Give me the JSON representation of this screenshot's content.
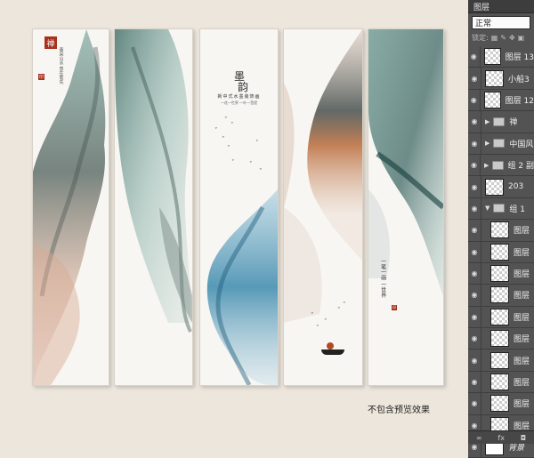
{
  "canvas": {
    "caption": "不包含预览效果",
    "panel1": {
      "seal": "禅",
      "small_seal": "印",
      "text": "墨染山水 意在笔先"
    },
    "panel3": {
      "title_top": "墨",
      "title_bottom": "韵",
      "line1": "新中式水墨装饰画",
      "line2": "一花一世界 一叶一菩提"
    },
    "panel5": {
      "text": "一笔一画 一世界",
      "seal": "印"
    }
  },
  "layers_panel": {
    "tab": "图层",
    "blend_mode": "正常",
    "lock_label": "锁定:",
    "layers": [
      {
        "name": "图层 13",
        "kind": "layer"
      },
      {
        "name": "小船3",
        "kind": "layer"
      },
      {
        "name": "图层 12",
        "kind": "layer"
      },
      {
        "name": "禅",
        "kind": "group-collapsed"
      },
      {
        "name": "中国风",
        "kind": "group-collapsed"
      },
      {
        "name": "组 2 副",
        "kind": "group-collapsed"
      },
      {
        "name": "203",
        "kind": "layer"
      },
      {
        "name": "组 1",
        "kind": "group-open"
      },
      {
        "name": "图层",
        "kind": "sublayer"
      },
      {
        "name": "图层",
        "kind": "sublayer"
      },
      {
        "name": "图层",
        "kind": "sublayer"
      },
      {
        "name": "图层",
        "kind": "sublayer"
      },
      {
        "name": "图层",
        "kind": "sublayer"
      },
      {
        "name": "图层",
        "kind": "sublayer"
      },
      {
        "name": "图层",
        "kind": "sublayer"
      },
      {
        "name": "图层",
        "kind": "sublayer"
      },
      {
        "name": "图层",
        "kind": "sublayer"
      },
      {
        "name": "图层",
        "kind": "sublayer"
      },
      {
        "name": "背景",
        "kind": "background"
      }
    ],
    "bottom_icons": [
      "link-icon",
      "fx-icon",
      "mask-icon"
    ],
    "bottom_labels": [
      "∞",
      "fx",
      "◘"
    ]
  }
}
